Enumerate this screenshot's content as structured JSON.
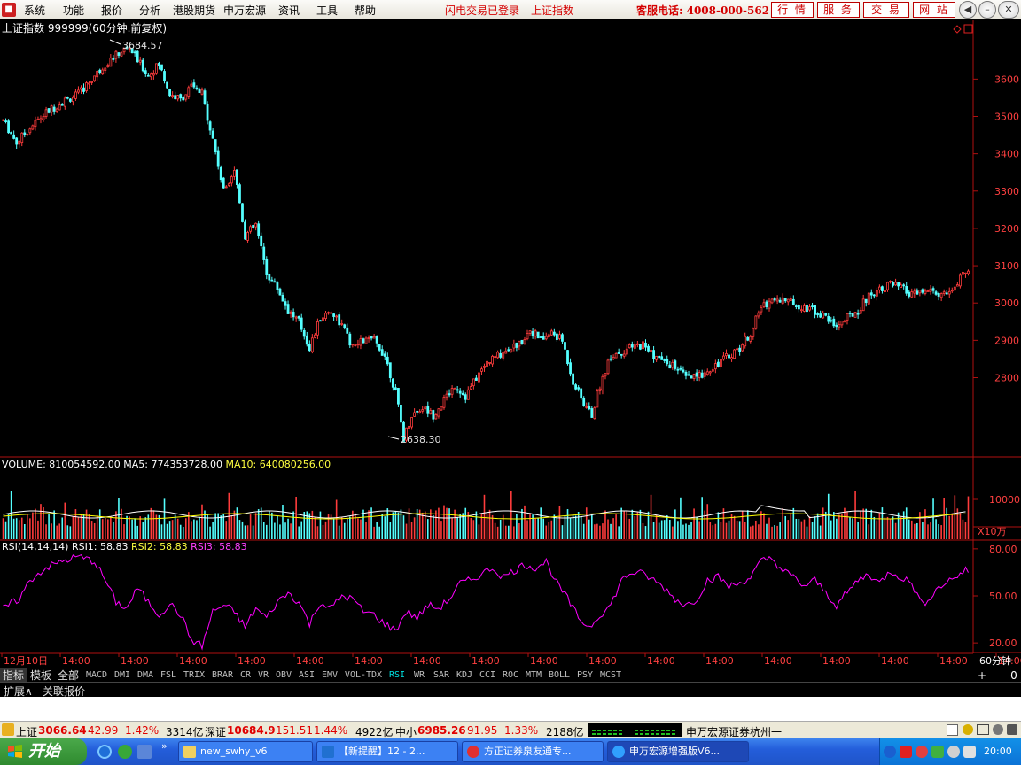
{
  "menu": {
    "items": [
      "系统",
      "功能",
      "报价",
      "分析",
      "港股期货",
      "申万宏源",
      "资讯",
      "工具",
      "帮助"
    ],
    "status_login": "闪电交易已登录",
    "status_index": "上证指数",
    "hotline": "客服电话: 4008-000-562",
    "buttons": [
      "行 情",
      "服 务",
      "交 易",
      "网 站"
    ],
    "window_buttons": [
      "back-icon",
      "minimize-icon",
      "restore-icon",
      "close-icon"
    ]
  },
  "main_panel": {
    "title": "上证指数 999999(60分钟.前复权)",
    "high_label": "3684.57",
    "low_label": "2638.30"
  },
  "volume_panel": {
    "vol_label": "VOLUME:",
    "vol_value": "810054592.00",
    "ma5_label": "MA5:",
    "ma5_value": "774353728.00",
    "ma10_label": "MA10:",
    "ma10_value": "640080256.00",
    "unit": "X10万"
  },
  "rsi_panel": {
    "name": "RSI(14,14,14)",
    "rsi1": "RSI1: 58.83",
    "rsi2": "RSI2: 58.83",
    "rsi3": "RSI3: 58.83"
  },
  "time_axis": {
    "labels": [
      "12月10日",
      "14:00",
      "14:00",
      "14:00",
      "14:00",
      "14:00",
      "14:00",
      "14:00",
      "14:00",
      "14:00",
      "14:00",
      "14:00",
      "14:00",
      "14:00",
      "14:00",
      "14:00",
      "14:00",
      "14:00"
    ],
    "period": "60分钟"
  },
  "indicator_tabs": {
    "side": [
      "指标",
      "模板",
      "全部"
    ],
    "items": [
      "MACD",
      "DMI",
      "DMA",
      "FSL",
      "TRIX",
      "BRAR",
      "CR",
      "VR",
      "OBV",
      "ASI",
      "EMV",
      "VOL-TDX",
      "RSI",
      "WR",
      "SAR",
      "KDJ",
      "CCI",
      "ROC",
      "MTM",
      "BOLL",
      "PSY",
      "MCST"
    ],
    "selected": "RSI",
    "controls": [
      "+",
      "-",
      "0"
    ]
  },
  "expand_row": [
    "扩展∧",
    "关联报价"
  ],
  "status_bar": {
    "sh_label": "上证",
    "sh_value": "3066.64",
    "sh_change": "42.99",
    "sh_pct": "1.42%",
    "sh_amount": "3314亿",
    "sz_label": "深证",
    "sz_value": "10684.9",
    "sz_change": "151.51",
    "sz_pct": "1.44%",
    "sz_amount": "4922亿",
    "zx_label": "中小",
    "zx_value": "6985.26",
    "zx_change": "91.95",
    "zx_pct": "1.33%",
    "zx_amount": "2188亿",
    "broker": "申万宏源证券杭州一"
  },
  "taskbar": {
    "start": "开始",
    "tasks": [
      "new_swhy_v6",
      "【新提醒】12 - 2...",
      "方正证券泉友通专...",
      "申万宏源增强版V6..."
    ],
    "clock": "20:00"
  },
  "colors": {
    "up": "#ff3c3c",
    "down": "#54ffff",
    "axis": "#b01010",
    "ma5": "#ffffff",
    "ma10": "#ffff00",
    "rsi": "#ff00ff"
  },
  "chart_data": {
    "type": "candlestick",
    "title": "上证指数 999999(60分钟.前复权)",
    "price_axis": {
      "ticks": [
        2800,
        2900,
        3000,
        3100,
        3200,
        3300,
        3400,
        3500,
        3600
      ],
      "range": [
        2590,
        3710
      ]
    },
    "price_path": [
      [
        0,
        3490
      ],
      [
        5,
        3430
      ],
      [
        10,
        3470
      ],
      [
        16,
        3510
      ],
      [
        22,
        3540
      ],
      [
        28,
        3560
      ],
      [
        33,
        3600
      ],
      [
        38,
        3640
      ],
      [
        43,
        3670
      ],
      [
        47,
        3684.57
      ],
      [
        50,
        3650
      ],
      [
        54,
        3610
      ],
      [
        58,
        3640
      ],
      [
        62,
        3560
      ],
      [
        66,
        3545
      ],
      [
        70,
        3580
      ],
      [
        74,
        3560
      ],
      [
        78,
        3440
      ],
      [
        82,
        3300
      ],
      [
        86,
        3360
      ],
      [
        90,
        3180
      ],
      [
        94,
        3210
      ],
      [
        98,
        3080
      ],
      [
        102,
        3040
      ],
      [
        106,
        2980
      ],
      [
        110,
        2950
      ],
      [
        114,
        2880
      ],
      [
        118,
        2960
      ],
      [
        122,
        2980
      ],
      [
        126,
        2940
      ],
      [
        130,
        2880
      ],
      [
        134,
        2900
      ],
      [
        138,
        2900
      ],
      [
        142,
        2860
      ],
      [
        146,
        2760
      ],
      [
        149,
        2638.3
      ],
      [
        152,
        2700
      ],
      [
        156,
        2720
      ],
      [
        160,
        2700
      ],
      [
        164,
        2740
      ],
      [
        168,
        2780
      ],
      [
        172,
        2750
      ],
      [
        176,
        2800
      ],
      [
        180,
        2840
      ],
      [
        184,
        2860
      ],
      [
        188,
        2880
      ],
      [
        192,
        2890
      ],
      [
        196,
        2930
      ],
      [
        200,
        2900
      ],
      [
        204,
        2920
      ],
      [
        208,
        2900
      ],
      [
        212,
        2790
      ],
      [
        216,
        2730
      ],
      [
        219,
        2700
      ],
      [
        222,
        2780
      ],
      [
        226,
        2860
      ],
      [
        230,
        2870
      ],
      [
        234,
        2880
      ],
      [
        238,
        2890
      ],
      [
        242,
        2860
      ],
      [
        246,
        2840
      ],
      [
        250,
        2830
      ],
      [
        254,
        2800
      ],
      [
        258,
        2800
      ],
      [
        262,
        2820
      ],
      [
        266,
        2840
      ],
      [
        270,
        2860
      ],
      [
        274,
        2880
      ],
      [
        278,
        2920
      ],
      [
        282,
        2990
      ],
      [
        286,
        3010
      ],
      [
        290,
        3010
      ],
      [
        294,
        3000
      ],
      [
        298,
        2990
      ],
      [
        302,
        2980
      ],
      [
        306,
        2960
      ],
      [
        310,
        2940
      ],
      [
        314,
        2960
      ],
      [
        318,
        2980
      ],
      [
        322,
        3020
      ],
      [
        326,
        3040
      ],
      [
        330,
        3050
      ],
      [
        334,
        3040
      ],
      [
        338,
        3020
      ],
      [
        342,
        3030
      ],
      [
        346,
        3030
      ],
      [
        350,
        3020
      ],
      [
        354,
        3040
      ],
      [
        358,
        3090
      ]
    ],
    "volume_axis": {
      "ticks": [
        10000
      ],
      "unit": "X10万"
    },
    "rsi_axis": {
      "ticks": [
        20,
        50,
        80
      ],
      "range": [
        15,
        85
      ]
    },
    "rsi_path": [
      [
        0,
        42
      ],
      [
        6,
        48
      ],
      [
        10,
        60
      ],
      [
        16,
        68
      ],
      [
        22,
        72
      ],
      [
        28,
        75
      ],
      [
        34,
        72
      ],
      [
        38,
        60
      ],
      [
        42,
        46
      ],
      [
        46,
        42
      ],
      [
        50,
        55
      ],
      [
        54,
        46
      ],
      [
        58,
        38
      ],
      [
        62,
        45
      ],
      [
        66,
        38
      ],
      [
        70,
        22
      ],
      [
        74,
        18
      ],
      [
        78,
        40
      ],
      [
        82,
        44
      ],
      [
        86,
        40
      ],
      [
        90,
        30
      ],
      [
        94,
        42
      ],
      [
        98,
        36
      ],
      [
        102,
        46
      ],
      [
        106,
        52
      ],
      [
        110,
        46
      ],
      [
        114,
        32
      ],
      [
        118,
        46
      ],
      [
        122,
        42
      ],
      [
        126,
        50
      ],
      [
        130,
        48
      ],
      [
        134,
        40
      ],
      [
        138,
        38
      ],
      [
        142,
        32
      ],
      [
        146,
        28
      ],
      [
        150,
        40
      ],
      [
        154,
        36
      ],
      [
        158,
        44
      ],
      [
        162,
        42
      ],
      [
        166,
        48
      ],
      [
        170,
        58
      ],
      [
        174,
        60
      ],
      [
        178,
        64
      ],
      [
        182,
        68
      ],
      [
        186,
        62
      ],
      [
        190,
        66
      ],
      [
        194,
        70
      ],
      [
        198,
        68
      ],
      [
        202,
        72
      ],
      [
        206,
        58
      ],
      [
        210,
        48
      ],
      [
        214,
        36
      ],
      [
        218,
        30
      ],
      [
        222,
        38
      ],
      [
        226,
        44
      ],
      [
        230,
        60
      ],
      [
        234,
        65
      ],
      [
        238,
        64
      ],
      [
        242,
        60
      ],
      [
        246,
        55
      ],
      [
        250,
        48
      ],
      [
        254,
        44
      ],
      [
        258,
        48
      ],
      [
        262,
        60
      ],
      [
        266,
        62
      ],
      [
        270,
        56
      ],
      [
        274,
        58
      ],
      [
        278,
        62
      ],
      [
        282,
        72
      ],
      [
        286,
        74
      ],
      [
        290,
        66
      ],
      [
        294,
        62
      ],
      [
        298,
        56
      ],
      [
        302,
        60
      ],
      [
        306,
        52
      ],
      [
        310,
        44
      ],
      [
        314,
        52
      ],
      [
        318,
        60
      ],
      [
        322,
        64
      ],
      [
        326,
        58
      ],
      [
        330,
        66
      ],
      [
        334,
        62
      ],
      [
        338,
        58
      ],
      [
        342,
        44
      ],
      [
        346,
        52
      ],
      [
        350,
        58
      ],
      [
        354,
        62
      ],
      [
        358,
        66
      ]
    ]
  }
}
